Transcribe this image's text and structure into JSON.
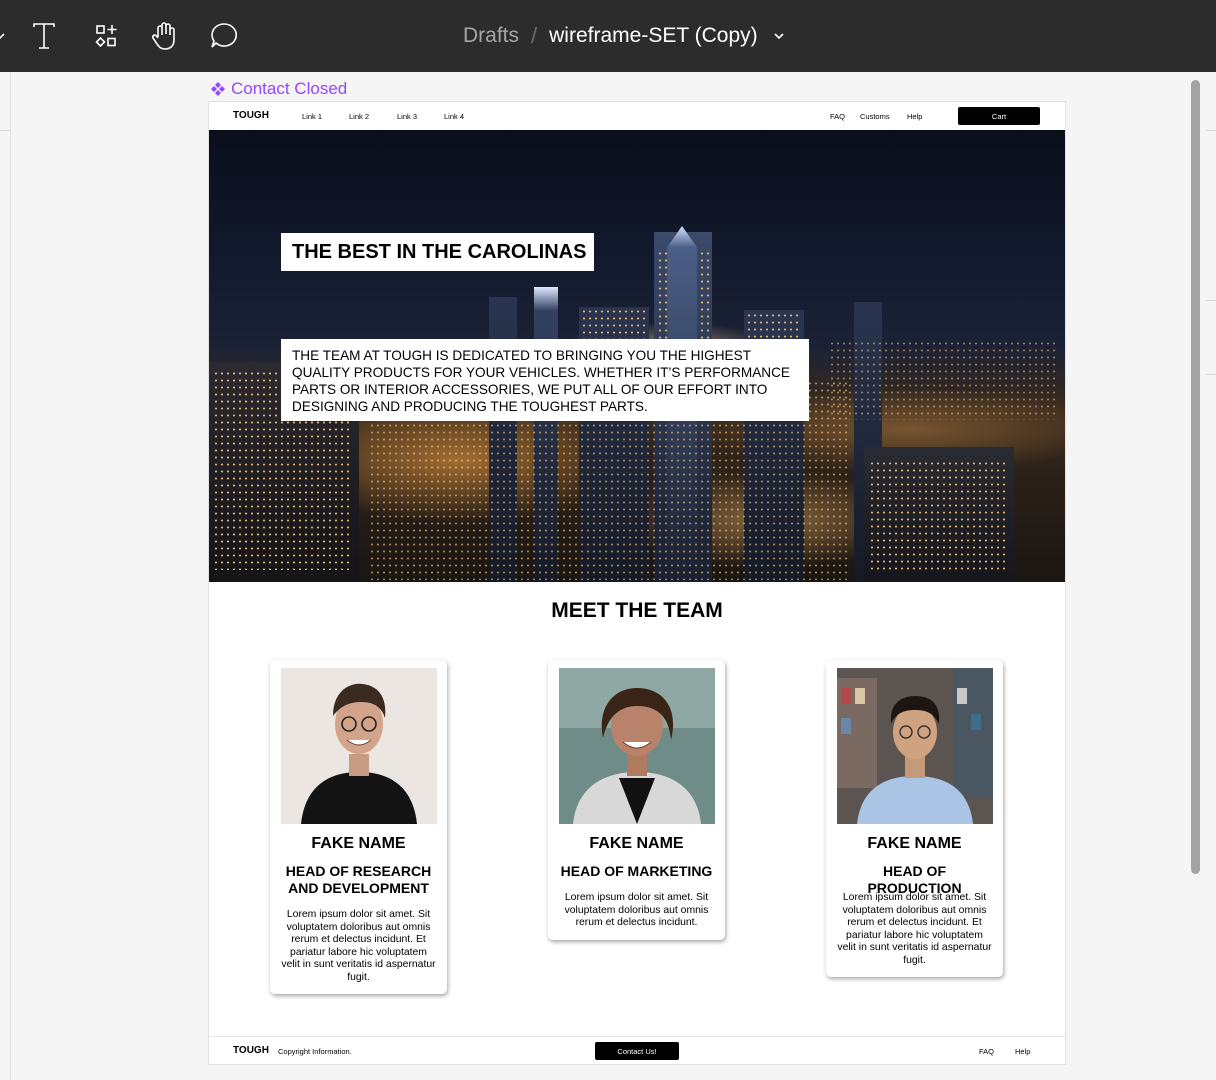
{
  "toolbar": {
    "breadcrumb_root": "Drafts",
    "breadcrumb_sep": "/",
    "file_name": "wireframe-SET (Copy)"
  },
  "frame": {
    "label": "Contact Closed"
  },
  "site": {
    "brand": "TOUGH",
    "nav_links": [
      "Link 1",
      "Link 2",
      "Link 3",
      "Link 4"
    ],
    "nav_right": [
      "FAQ",
      "Customs",
      "Help"
    ],
    "cart_label": "Cart",
    "hero_title": "THE BEST IN THE CAROLINAS",
    "hero_text": "THE TEAM AT TOUGH IS DEDICATED TO BRINGING YOU THE HIGHEST QUALITY PRODUCTS FOR YOUR VEHICLES. WHETHER IT’S PERFORMANCE PARTS OR INTERIOR ACCESSORIES, WE PUT ALL OF OUR EFFORT INTO DESIGNING AND PRODUCING THE TOUGHEST PARTS.",
    "section_title": "MEET THE TEAM",
    "team": [
      {
        "name": "FAKE NAME",
        "role": "HEAD OF RESEARCH AND DEVELOPMENT",
        "desc": "Lorem ipsum dolor sit amet. Sit voluptatem doloribus aut omnis rerum et delectus incidunt. Et pariatur labore hic voluptatem velit in sunt veritatis id aspernatur fugit."
      },
      {
        "name": "FAKE NAME",
        "role": "HEAD OF MARKETING",
        "desc": "Lorem ipsum dolor sit amet. Sit voluptatem doloribus aut omnis rerum et delectus incidunt."
      },
      {
        "name": "FAKE NAME",
        "role": "HEAD OF PRODUCTION",
        "desc": "Lorem ipsum dolor sit amet. Sit voluptatem doloribus aut omnis rerum et delectus incidunt. Et pariatur labore hic voluptatem velit in sunt veritatis id aspernatur fugit."
      }
    ],
    "footer": {
      "brand": "TOUGH",
      "copyright": "Copyright Information.",
      "contact_label": "Contact Us!",
      "links": [
        "FAQ",
        "Help"
      ]
    }
  },
  "icons": [
    "chevron-down-icon",
    "text-tool-icon",
    "resources-icon",
    "hand-tool-icon",
    "comment-icon",
    "component-icon"
  ],
  "colors": {
    "toolbar_bg": "#2c2c2c",
    "canvas_bg": "#f5f5f5",
    "frame_label": "#9747ff",
    "button_bg": "#000000"
  }
}
